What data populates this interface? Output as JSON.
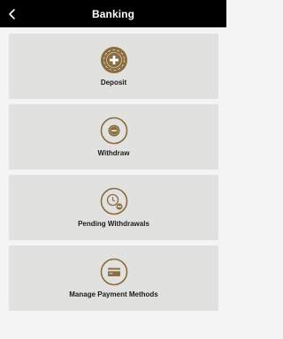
{
  "header": {
    "title": "Banking",
    "back_icon": "chevron-left-icon"
  },
  "accent_color": "#8b6d3e",
  "menu": [
    {
      "label": "Deposit",
      "icon": "plus-chip-icon"
    },
    {
      "label": "Withdraw",
      "icon": "coin-in-circle-icon"
    },
    {
      "label": "Pending Withdrawals",
      "icon": "clock-minus-icon"
    },
    {
      "label": "Manage Payment Methods",
      "icon": "credit-card-icon"
    }
  ]
}
